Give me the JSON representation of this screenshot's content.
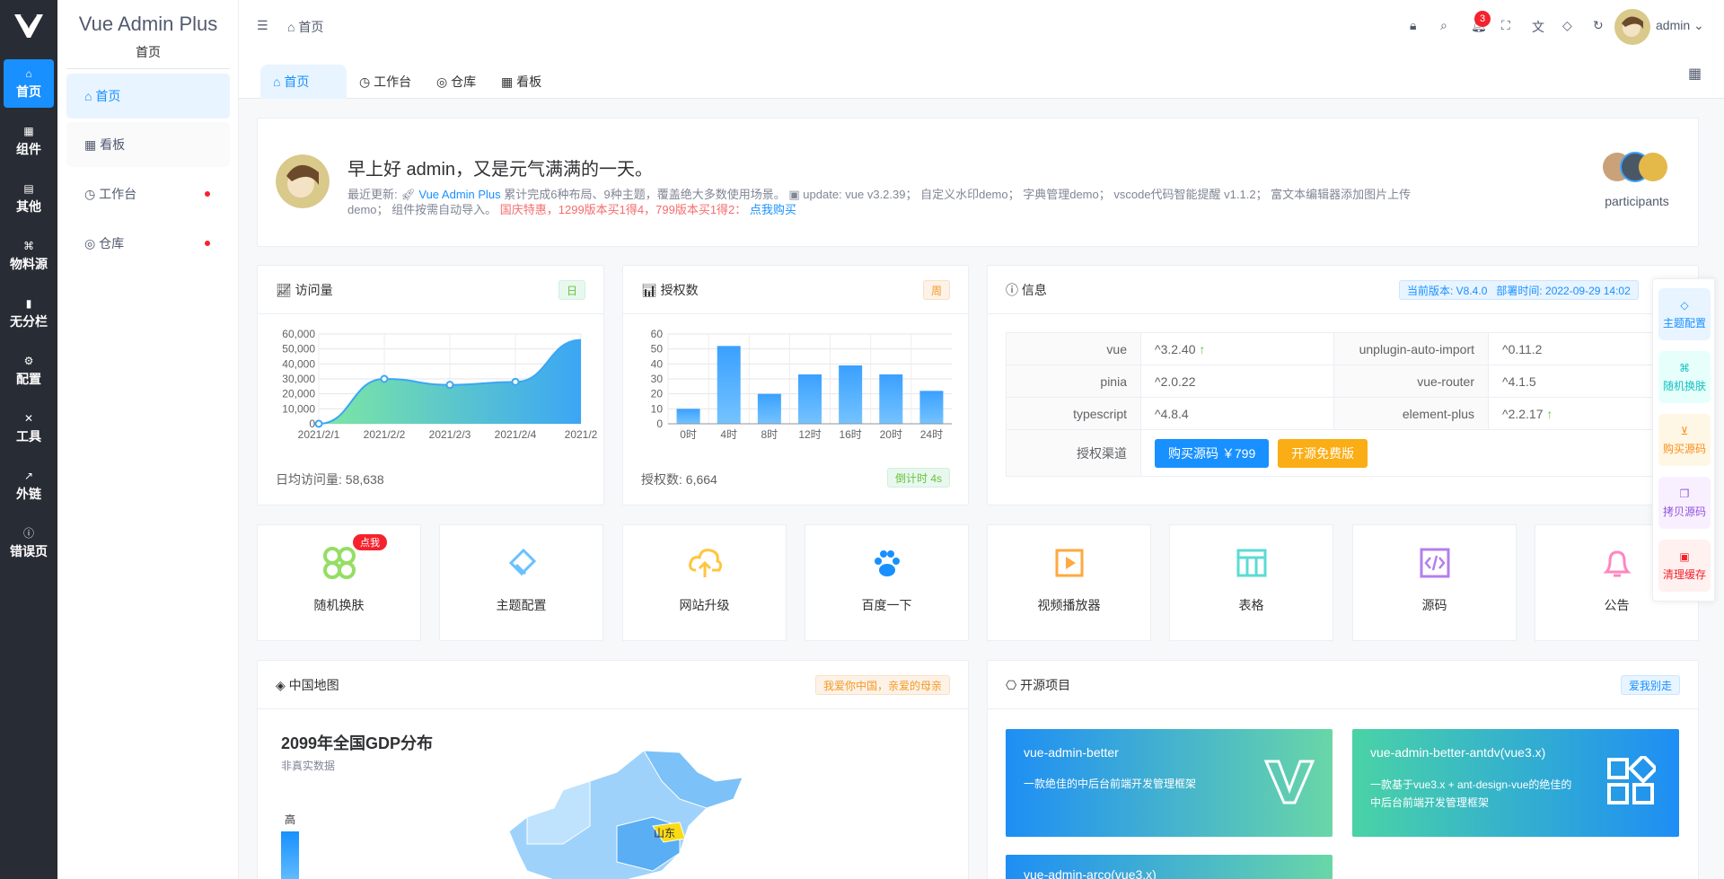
{
  "rail": {
    "items": [
      {
        "icon": "⌂",
        "label": "首页"
      },
      {
        "icon": "▦",
        "label": "组件"
      },
      {
        "icon": "▤",
        "label": "其他"
      },
      {
        "icon": "⌘",
        "label": "物料源"
      },
      {
        "icon": "▮",
        "label": "无分栏"
      },
      {
        "icon": "⚙",
        "label": "配置"
      },
      {
        "icon": "✕",
        "label": "工具"
      },
      {
        "icon": "↗",
        "label": "外链"
      },
      {
        "icon": "ⓘ",
        "label": "错误页"
      }
    ]
  },
  "sidebar": {
    "brand": "Vue Admin Plus",
    "section": "首页",
    "items": [
      {
        "icon": "⌂",
        "label": "首页"
      },
      {
        "icon": "▦",
        "label": "看板"
      },
      {
        "icon": "◷",
        "label": "工作台"
      },
      {
        "icon": "◎",
        "label": "仓库"
      }
    ]
  },
  "header": {
    "breadcrumb": "首页",
    "notification_count": "3",
    "username": "admin"
  },
  "tabs": [
    {
      "icon": "⌂",
      "label": "首页"
    },
    {
      "icon": "◷",
      "label": "工作台"
    },
    {
      "icon": "◎",
      "label": "仓库"
    },
    {
      "icon": "▦",
      "label": "看板"
    }
  ],
  "welcome": {
    "greeting": "早上好 admin，又是元气满满的一天。",
    "line1_prefix": "最近更新: ",
    "link_name": "Vue Admin Plus",
    "line1_mid": " 累计完成6种布局、9种主题，覆盖绝大多数使用场景。 ",
    "line1_update": "update:  vue v3.2.39；  自定义水印demo；  字典管理demo；  vscode代码智能提醒 v1.1.2；  富文本编辑器添加图片上传",
    "line2": "demo；  组件按需自动导入。 ",
    "promo": "国庆特惠，1299版本买1得4，799版本买1得2：",
    "buy_link": "点我购买",
    "participants": "participants"
  },
  "visits": {
    "title": "访问量",
    "tag": "日",
    "footer": "日均访问量: 58,638"
  },
  "auth": {
    "title": "授权数",
    "tag": "周",
    "footer": "授权数: 6,664",
    "countdown": "倒计时 4s"
  },
  "chart_data": [
    {
      "type": "area",
      "x": [
        "2021/2/1",
        "2021/2/2",
        "2021/2/3",
        "2021/2/4",
        "2021/2/5"
      ],
      "x_tick_labels": [
        "2021/2/1",
        "2021/2/2",
        "2021/2/3",
        "2021/2/4",
        "2021/2"
      ],
      "values": [
        0,
        30000,
        26000,
        28000,
        56000
      ],
      "yticks": [
        "60,000",
        "50,000",
        "40,000",
        "30,000",
        "20,000",
        "10,000",
        "0"
      ],
      "ylim": [
        0,
        60000
      ],
      "grid": true,
      "color": "#1890ff"
    },
    {
      "type": "bar",
      "categories": [
        "0时",
        "4时",
        "8时",
        "12时",
        "16时",
        "20时",
        "24时"
      ],
      "values": [
        10,
        52,
        20,
        33,
        39,
        33,
        22
      ],
      "yticks": [
        "60",
        "50",
        "40",
        "30",
        "20",
        "10",
        "0"
      ],
      "ylim": [
        0,
        60
      ],
      "grid": true,
      "color": "#1890ff"
    }
  ],
  "info": {
    "title": "信息",
    "version_tag": "当前版本: V8.4.0   部署时间: 2022-09-29 14:02",
    "rows": [
      {
        "k1": "vue",
        "v1": "^3.2.40",
        "up1": true,
        "k2": "unplugin-auto-import",
        "v2": "^0.11.2",
        "up2": false
      },
      {
        "k1": "pinia",
        "v1": "^2.0.22",
        "up1": false,
        "k2": "vue-router",
        "v2": "^4.1.5",
        "up2": false
      },
      {
        "k1": "typescript",
        "v1": "^4.8.4",
        "up1": false,
        "k2": "element-plus",
        "v2": "^2.2.17",
        "up2": true
      }
    ],
    "channel_label": "授权渠道",
    "buy_button": "购买源码 ￥799",
    "free_button": "开源免费版"
  },
  "quick": [
    {
      "label": "随机换肤",
      "icon": "clover-icon",
      "color": "#95de64",
      "badge": "点我"
    },
    {
      "label": "主题配置",
      "icon": "brush-icon",
      "color": "#69c0ff"
    },
    {
      "label": "网站升级",
      "icon": "cloud-upload-icon",
      "color": "#ffc53d"
    },
    {
      "label": "百度一下",
      "icon": "paw-icon",
      "color": "#1890ff"
    },
    {
      "label": "视频播放器",
      "icon": "video-icon",
      "color": "#ffa940"
    },
    {
      "label": "表格",
      "icon": "table-icon",
      "color": "#5cdbd3"
    },
    {
      "label": "源码",
      "icon": "code-icon",
      "color": "#b37feb"
    },
    {
      "label": "公告",
      "icon": "bell-icon",
      "color": "#ff85c0"
    }
  ],
  "map": {
    "title": "中国地图",
    "tag": "我爱你中国，亲爱的母亲",
    "heading": "2099年全国GDP分布",
    "sub": "非真实数据",
    "legend_high": "高",
    "highlight": "山东"
  },
  "open_source": {
    "title": "开源项目",
    "tag": "爱我别走",
    "projects": [
      {
        "name": "vue-admin-better",
        "desc": "一款绝佳的中后台前端开发管理框架"
      },
      {
        "name": "vue-admin-better-antdv(vue3.x)",
        "desc": "一款基于vue3.x + ant-design-vue的绝佳的中后台前端开发管理框架"
      },
      {
        "name": "vue-admin-arco(vue3.x)",
        "desc": ""
      }
    ]
  },
  "float_panel": [
    {
      "icon": "◇",
      "label": "主题配置",
      "bg": "#e8f4ff",
      "color": "#1890ff"
    },
    {
      "icon": "⌘",
      "label": "随机换肤",
      "bg": "#e6fffb",
      "color": "#13c2c2"
    },
    {
      "icon": "⊻",
      "label": "购买源码",
      "bg": "#fff7e6",
      "color": "#fa8c16"
    },
    {
      "icon": "❐",
      "label": "拷贝源码",
      "bg": "#f9f0ff",
      "color": "#9254de"
    },
    {
      "icon": "▣",
      "label": "清理缓存",
      "bg": "#fff1f0",
      "color": "#f5222d"
    }
  ]
}
